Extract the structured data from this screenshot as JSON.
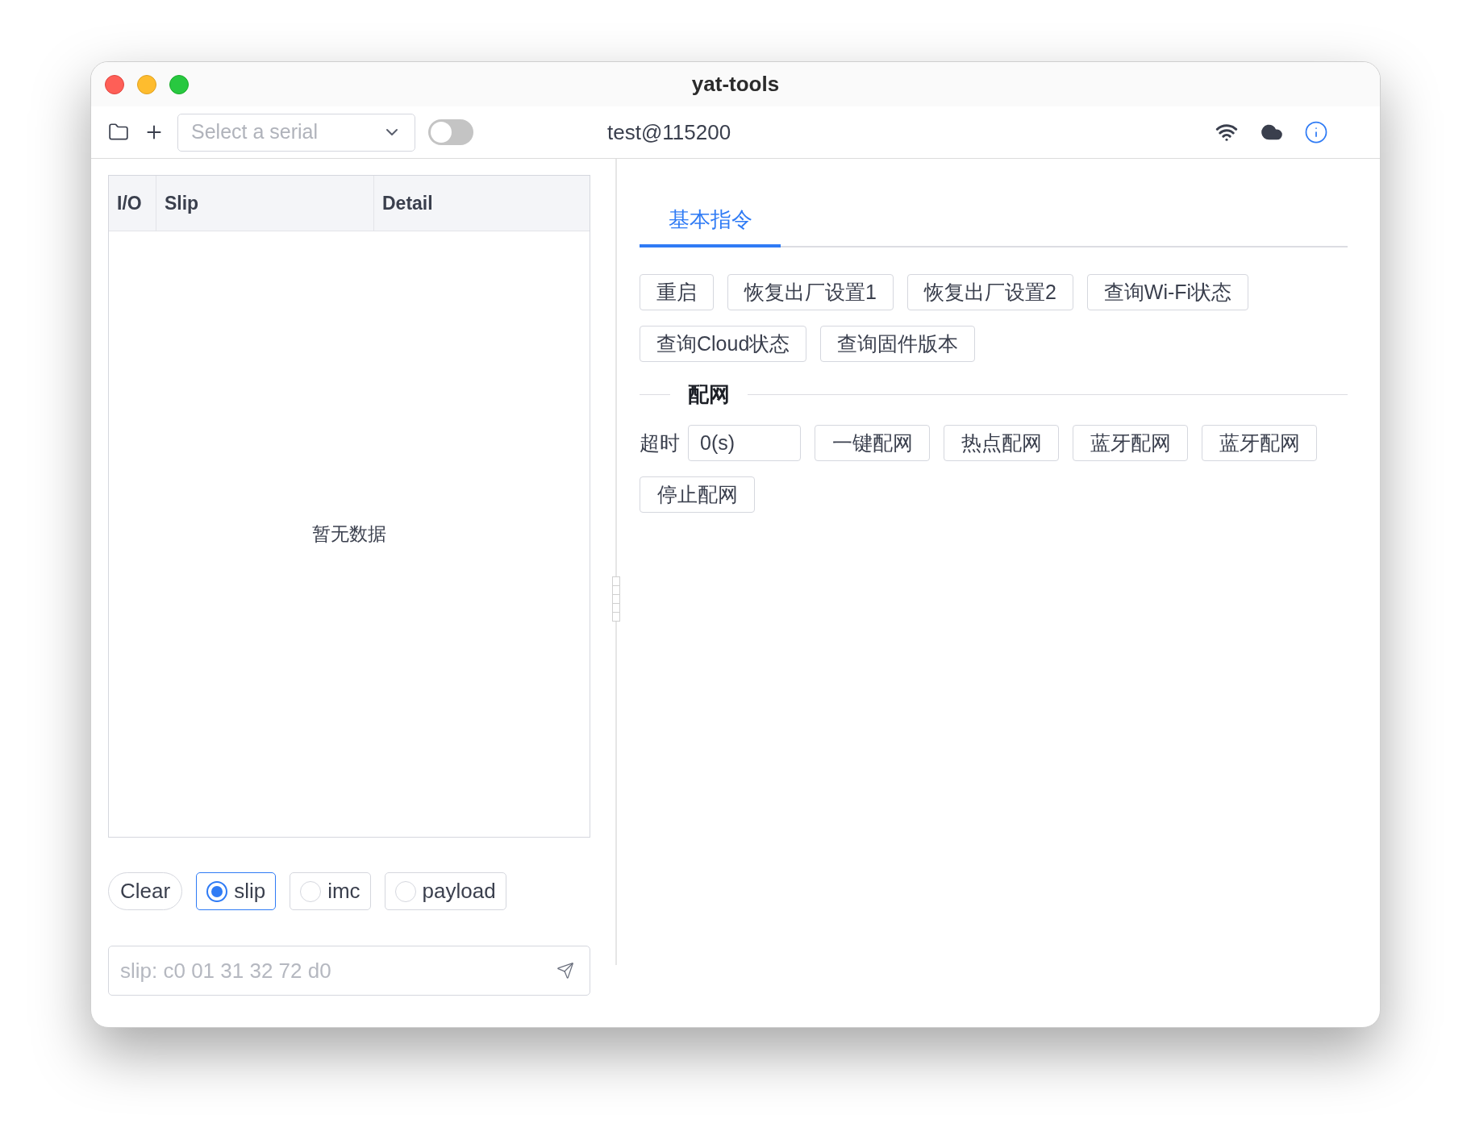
{
  "window": {
    "title": "yat-tools"
  },
  "toolbar": {
    "serial_select": {
      "placeholder": "Select a serial"
    },
    "toggle": {
      "on": false
    },
    "connection": "test@115200"
  },
  "log_table": {
    "columns": [
      "I/O",
      "Slip",
      "Detail"
    ],
    "empty_text": "暂无数据"
  },
  "log_controls": {
    "clear_button": "Clear",
    "formats": [
      {
        "label": "slip",
        "selected": true
      },
      {
        "label": "imc",
        "selected": false
      },
      {
        "label": "payload",
        "selected": false
      }
    ]
  },
  "send_field": {
    "placeholder": "slip: c0 01 31 32 72 d0"
  },
  "tabs": [
    {
      "label": "基本指令",
      "selected": true
    }
  ],
  "basic_commands": [
    "重启",
    "恢复出厂设置1",
    "恢复出厂设置2",
    "查询Wi-Fi状态",
    "查询Cloud状态",
    "查询固件版本"
  ],
  "network_section": {
    "title": "配网",
    "timeout_label": "超时",
    "timeout_value": "0(s)",
    "buttons": [
      "一键配网",
      "热点配网",
      "蓝牙配网",
      "蓝牙配网",
      "停止配网"
    ]
  }
}
